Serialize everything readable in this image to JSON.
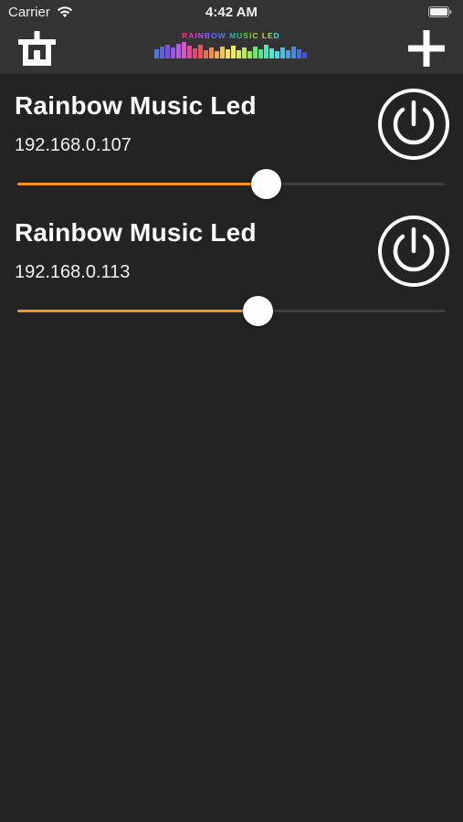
{
  "status_bar": {
    "carrier": "Carrier",
    "time": "4:42 AM",
    "wifi_icon": "wifi-icon",
    "battery_icon": "battery-icon"
  },
  "nav": {
    "left_icon": "remove-device-icon",
    "logo_text": "RAINBOW MUSIC LED",
    "add_icon": "plus-icon"
  },
  "devices": [
    {
      "name": "Rainbow Music Led",
      "ip": "192.168.0.107",
      "brightness": 0.58,
      "power_icon": "power-icon"
    },
    {
      "name": "Rainbow Music Led",
      "ip": "192.168.0.113",
      "brightness": 0.56,
      "power_icon": "power-icon"
    }
  ],
  "colors": {
    "background": "#232323",
    "bar": "#333333",
    "accent": "#f7931e",
    "text": "#ffffff"
  }
}
